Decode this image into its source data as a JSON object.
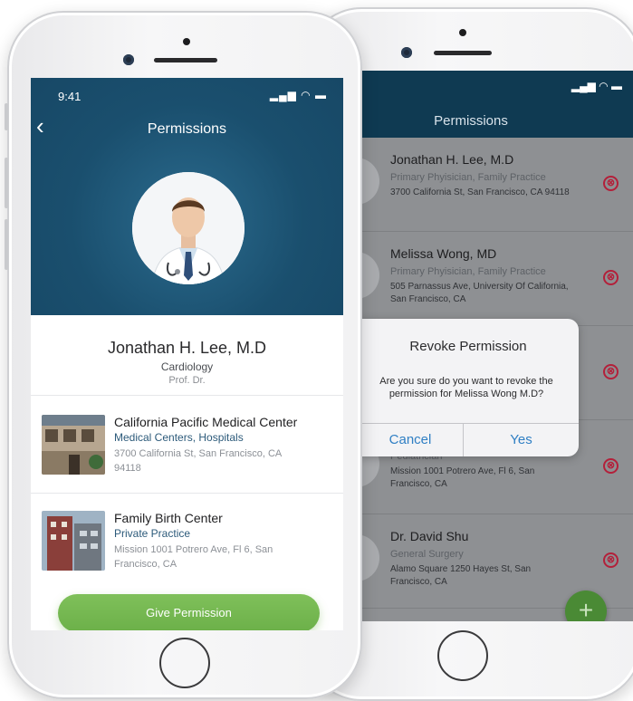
{
  "back_screen": {
    "title": "Permissions",
    "status_icons": "▂▄▆ ◠ ▬",
    "doctors": [
      {
        "name": "Jonathan H. Lee, M.D",
        "specialty": "Primary Phyisician, Family Practice",
        "address": "3700 California St, San Francisco, CA 94118"
      },
      {
        "name": "Melissa Wong, MD",
        "specialty": "Primary Phyisician, Family Practice",
        "address": "505 Parnassus Ave, University Of California, San Francisco, CA"
      },
      {
        "name": "",
        "specialty": "",
        "address": ""
      },
      {
        "name": "",
        "specialty": "Pediatrician",
        "address": "Mission 1001 Potrero Ave, Fl 6, San Francisco, CA"
      },
      {
        "name": "Dr. David Shu",
        "specialty": "General Surgery",
        "address": "Alamo Square 1250 Hayes St, San Francisco, CA"
      }
    ],
    "dialog": {
      "title": "Revoke Permission",
      "message": "Are you sure do you want to revoke the permission for Melissa Wong M.D?",
      "cancel_label": "Cancel",
      "yes_label": "Yes"
    },
    "fab_label": "+",
    "revoke_icon": "⊗"
  },
  "front_screen": {
    "status_time": "9:41",
    "status_icons": "▂▄▆ ◠ ▬",
    "back_icon": "‹",
    "title": "Permissions",
    "profile": {
      "name": "Jonathan H. Lee, M.D",
      "specialty": "Cardiology",
      "title": "Prof. Dr."
    },
    "centers": [
      {
        "name": "California Pacific Medical Center",
        "type": "Medical Centers, Hospitals",
        "address": "3700 California St, San Francisco, CA 94118"
      },
      {
        "name": "Family Birth Center",
        "type": "Private Practice",
        "address": "Mission 1001 Potrero Ave, Fl 6, San Francisco, CA"
      }
    ],
    "give_permission_label": "Give Permission"
  },
  "colors": {
    "header_blue": "#1a4f6e",
    "accent_green": "#6cb049",
    "revoke_red": "#b3203a",
    "dialog_button_blue": "#2f7fc4"
  }
}
